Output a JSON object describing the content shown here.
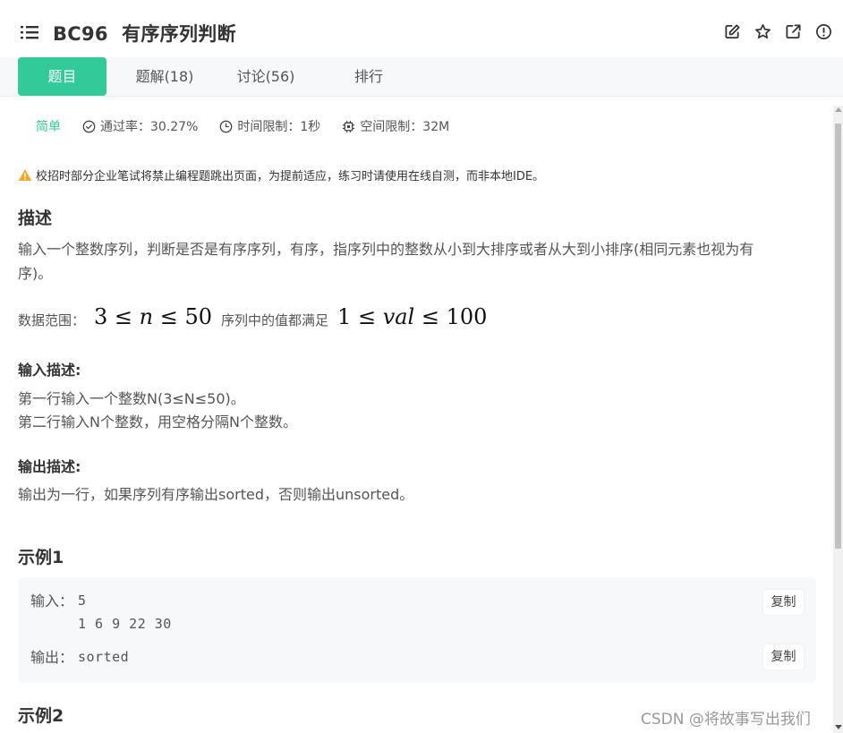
{
  "header": {
    "title": "BC96  有序序列判断",
    "icons": [
      "menu-list-icon",
      "edit-icon",
      "star-icon",
      "share-icon",
      "info-icon"
    ]
  },
  "tabs": [
    {
      "label": "题目",
      "active": true
    },
    {
      "label": "题解(18)",
      "active": false
    },
    {
      "label": "讨论(56)",
      "active": false
    },
    {
      "label": "排行",
      "active": false
    }
  ],
  "meta": {
    "difficulty": "简单",
    "pass_rate": "通过率：30.27%",
    "time_limit": "时间限制：1秒",
    "space_limit": "空间限制：32M"
  },
  "notice": "校招时部分企业笔试将禁止编程题跳出页面，为提前适应，练习时请使用在线自测，而非本地IDE。",
  "description": {
    "heading": "描述",
    "text_line1": "输入一个整数序列，判断是否是有序序列，有序，指序列中的整数从小到大排序或者从大到小排序(相同元素也视为有",
    "text_line2": "序)。",
    "range_label": "数据范围：",
    "range_mid": "序列中的值都满足"
  },
  "input_desc": {
    "heading": "输入描述:",
    "line1": "第一行输入一个整数N(3≤N≤50)。",
    "line2": "第二行输入N个整数，用空格分隔N个整数。"
  },
  "output_desc": {
    "heading": "输出描述:",
    "line1": "输出为一行，如果序列有序输出sorted，否则输出unsorted。"
  },
  "example1": {
    "heading": "示例1",
    "input_label": "输入：",
    "input_value": "5\n1 6 9 22 30",
    "output_label": "输出：",
    "output_value": "sorted",
    "copy_label": "复制"
  },
  "example2": {
    "heading": "示例2"
  },
  "watermark": "CSDN @将故事写出我们",
  "colors": {
    "accent": "#32ca99",
    "tab_bar_bg": "#f7f8fa",
    "example_bg": "#f7f8fa",
    "warning": "#f5a623"
  }
}
